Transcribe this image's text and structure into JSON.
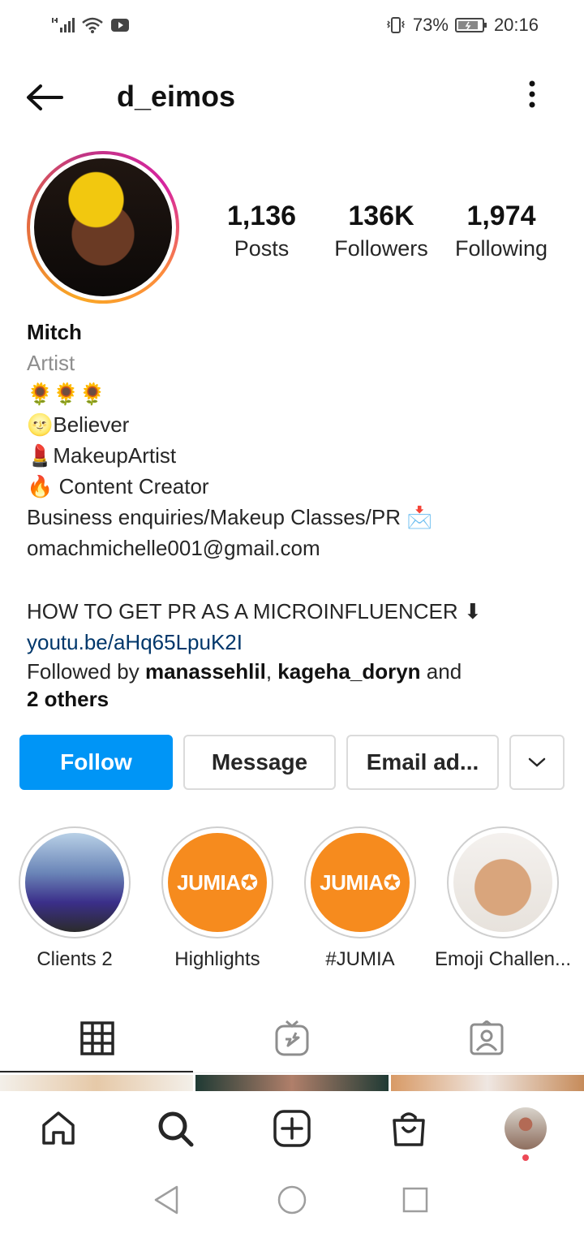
{
  "status_bar": {
    "battery": "73%",
    "time": "20:16"
  },
  "header": {
    "username": "d_eimos"
  },
  "profile": {
    "posts": {
      "count": "1,136",
      "label": "Posts"
    },
    "followers": {
      "count": "136K",
      "label": "Followers"
    },
    "following": {
      "count": "1,974",
      "label": "Following"
    }
  },
  "bio": {
    "name": "Mitch",
    "category": "Artist",
    "lines": [
      "🌻🌻🌻",
      "🌝Believer",
      "💄MakeupArtist",
      "🔥 Content Creator",
      "Business enquiries/Makeup Classes/PR 📩",
      "omachmichelle001@gmail.com"
    ],
    "video_line": "HOW TO GET PR AS A MICROINFLUENCER ⬇",
    "link": "youtu.be/aHq65LpuK2I",
    "followed_by_prefix": "Followed by ",
    "followed_by_user1": "manassehlil",
    "followed_by_sep": ", ",
    "followed_by_user2": "kageha_doryn",
    "followed_by_and": " and",
    "followed_by_others": "2 others"
  },
  "actions": {
    "follow": "Follow",
    "message": "Message",
    "email": "Email ad..."
  },
  "highlights": [
    {
      "label": "Clients 2"
    },
    {
      "label": "Highlights",
      "logo_text": "JUMIA"
    },
    {
      "label": "#JUMIA",
      "logo_text": "JUMIA"
    },
    {
      "label": "Emoji Challen..."
    }
  ],
  "colors": {
    "follow_button": "#0095f6",
    "link": "#00376b",
    "jumia_orange": "#f68b1e",
    "notification_dot": "#ed4956"
  },
  "tabs": [
    "grid-icon",
    "igtv-icon",
    "tagged-icon"
  ],
  "bottom_nav": [
    "home-icon",
    "search-icon",
    "add-post-icon",
    "shop-icon",
    "profile-avatar"
  ]
}
